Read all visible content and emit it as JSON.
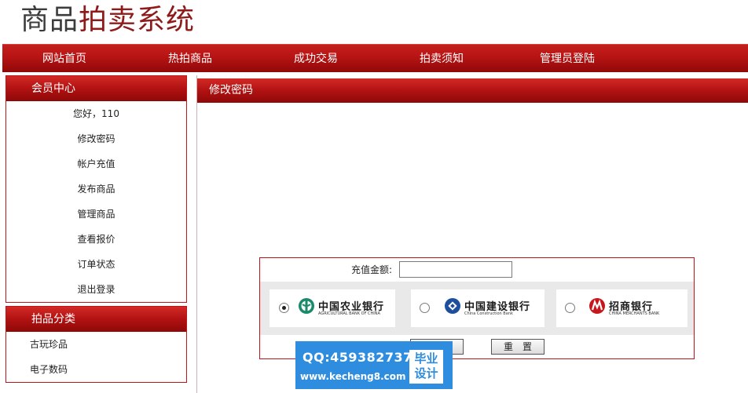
{
  "logo": {
    "part1": "商品",
    "part2": "拍卖系统"
  },
  "nav": [
    "网站首页",
    "热拍商品",
    "成功交易",
    "拍卖须知",
    "管理员登陆"
  ],
  "member_panel": {
    "title": "会员中心",
    "greeting": "您好，110",
    "items": [
      "修改密码",
      "帐户充值",
      "发布商品",
      "管理商品",
      "查看报价",
      "订单状态",
      "退出登录"
    ]
  },
  "category_panel": {
    "title": "拍品分类",
    "items": [
      "古玩珍品",
      "电子数码"
    ]
  },
  "main": {
    "title": "修改密码"
  },
  "recharge_form": {
    "amount_label": "充值金额:",
    "amount_value": "",
    "banks": [
      {
        "name": "中国农业银行",
        "en": "AGRICULTURAL BANK OF CHINA",
        "checked": true,
        "color": "#1a8a6a"
      },
      {
        "name": "中国建设银行",
        "en": "China Construction Bank",
        "checked": false,
        "color": "#1d4f9c"
      },
      {
        "name": "招商银行",
        "en": "CHINA MERCHANTS BANK",
        "checked": false,
        "color": "#c8161d"
      }
    ],
    "reset_label": "重　置"
  },
  "watermark": {
    "qq": "QQ:459382737",
    "url": "www.kecheng8.com",
    "badge_line1": "毕业",
    "badge_line2": "设计"
  }
}
